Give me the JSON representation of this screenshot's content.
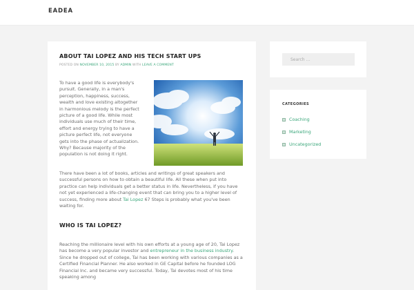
{
  "site": {
    "brand": "EADEA"
  },
  "post": {
    "title": "ABOUT TAI LOPEZ AND HIS TECH START UPS",
    "meta": {
      "posted_on": "POSTED ON",
      "date": "NOVEMBER 10, 2015",
      "by": "BY",
      "author": "ADMIN",
      "with": "WITH",
      "comment_link": "LEAVE A COMMENT"
    },
    "intro": "To have a good life is everybody's pursuit. Generally, in a man's perception, happiness, success, wealth and love existing altogether in harmonious melody is the perfect picture of a good life. While most individuals use much of their time, effort and energy trying to have a picture perfect life, not everyone gets into the phase of actualization. Why? Because majority of the population is not doing it right.",
    "p2_before": "There have been a lot of books, articles and writings of great speakers and successful persons on how to obtain a beautiful life. All these when put into practice can help individuals get a better status in life. Nevertheless, if you have not yet experienced a life-changing event that can bring you to a higher level of success, finding more about ",
    "p2_link": "Tai Lopez",
    "p2_after": " 67 Steps is probably what you've been waiting for.",
    "h2": "WHO IS TAI LOPEZ?",
    "p3_before": "Reaching the millionaire level with his own efforts at a young age of 20, Tai Lopez has become a very popular investor and ",
    "p3_link": "entrepreneur in the business industry",
    "p3_after": ". Since he dropped out of college, Tai has been working with various companies as a Certified Financial Planner. He also worked in GE Capital before he founded LOG Financial Inc. and became very successful. Today, Tai devotes most of his time speaking among"
  },
  "sidebar": {
    "search_placeholder": "Search ...",
    "categories_title": "CATEGORIES",
    "categories": [
      "Coaching",
      "Marketing",
      "Uncategorized"
    ]
  }
}
